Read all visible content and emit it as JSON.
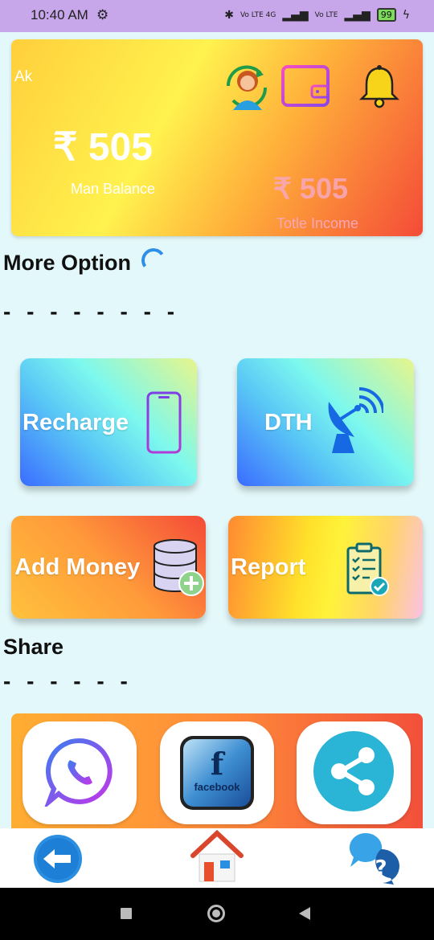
{
  "status_bar": {
    "time": "10:40 AM",
    "network_1": "Vo LTE 4G",
    "network_2": "Vo LTE",
    "battery": "99"
  },
  "wallet": {
    "user_name": "Ak",
    "currency_symbol": "₹",
    "main_balance_amount": "505",
    "main_balance_label": "Man Balance",
    "total_income_amount": "505",
    "total_income_label": "Totle Income",
    "icons": [
      "profile-refresh-icon",
      "wallet-icon",
      "bell-icon"
    ]
  },
  "more_option": {
    "title": "More Option",
    "dashes": "- - - - - - - -"
  },
  "options": [
    {
      "label": "Recharge",
      "icon": "phone-icon"
    },
    {
      "label": "DTH",
      "icon": "satellite-dish-icon"
    },
    {
      "label": "Add Money",
      "icon": "database-add-icon"
    },
    {
      "label": "Report",
      "icon": "clipboard-check-icon"
    }
  ],
  "share": {
    "title": "Share",
    "dashes": "- - - - - -",
    "buttons": [
      {
        "icon": "whatsapp-icon"
      },
      {
        "icon": "facebook-icon",
        "text": "facebook"
      },
      {
        "icon": "share-icon"
      }
    ]
  },
  "bottom_nav": {
    "items": [
      "back-icon",
      "home-icon",
      "help-chat-icon"
    ]
  },
  "colors": {
    "background": "#e3f8fa",
    "status_bar": "#c7a6ea",
    "accent_blue": "#2f8fe8"
  }
}
